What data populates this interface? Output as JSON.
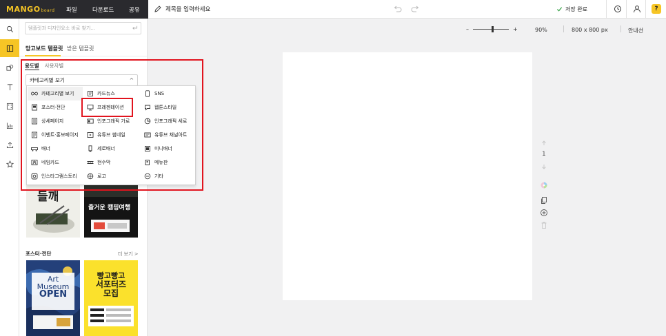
{
  "brand": {
    "logo_main": "MANGO",
    "logo_sub": "board"
  },
  "top_menu": [
    "파일",
    "다운로드",
    "공유"
  ],
  "title_placeholder": "제목을 입력하세요",
  "save_status": "저장 완료",
  "search": {
    "placeholder": "템플릿과 디자인요소 바로 찾기..."
  },
  "panel_tabs": [
    "망고보드 템플릿",
    "받은 템플릿"
  ],
  "sub_tabs": [
    "용도별",
    "사용자별"
  ],
  "category_select": {
    "value": "카테고리별 보기",
    "caret": "^"
  },
  "categories": [
    [
      "카테고리별 보기",
      "카드뉴스",
      "SNS"
    ],
    [
      "포스터·전단",
      "프레젠테이션",
      "웹툰스타일"
    ],
    [
      "상세페이지",
      "인포그래픽 가로",
      "인포그래픽 세로"
    ],
    [
      "이벤트·홍보페이지",
      "유튜브 썸네일",
      "유튜브 채널아트"
    ],
    [
      "배너",
      "세로배너",
      "미니배너"
    ],
    [
      "네임카드",
      "현수막",
      "메뉴판"
    ],
    [
      "인스타그램스토리",
      "로고",
      "기타"
    ]
  ],
  "section_poster": "포스터·전단",
  "more_link": "더 보기 >",
  "thumbs": {
    "t1_title": "들깨",
    "t2_title": "즐거운 캠핑여행",
    "t3_l1": "Art",
    "t3_l2": "Museum",
    "t3_l3": "OPEN",
    "t4_l1": "빵고빵고",
    "t4_l2": "서포터즈",
    "t4_l3": "모집"
  },
  "zoom": {
    "minus": "–",
    "plus": "+",
    "value": "90%",
    "level": 0.55
  },
  "canvas_size": "800 x 800 px",
  "guide": "안내선",
  "page_number": "1",
  "colors": {
    "accent": "#f6c525",
    "dark": "#2a2a2e",
    "highlight": "#e1141e"
  }
}
